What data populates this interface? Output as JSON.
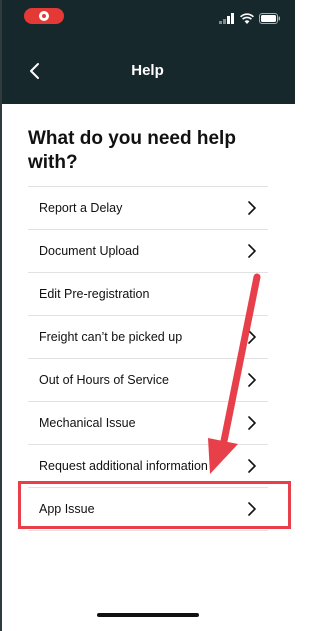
{
  "header": {
    "title": "Help"
  },
  "page": {
    "title": "What do you need help with?"
  },
  "help_items": [
    {
      "label": "Report a Delay"
    },
    {
      "label": "Document Upload"
    },
    {
      "label": "Edit Pre-registration"
    },
    {
      "label": "Freight can’t be picked up"
    },
    {
      "label": "Out of Hours of Service"
    },
    {
      "label": "Mechanical Issue"
    },
    {
      "label": "Request additional information"
    },
    {
      "label": "App Issue"
    }
  ],
  "icons": {
    "back": "chevron-left-icon",
    "row_chevron": "chevron-right-icon",
    "signal": "cellular-signal-icon",
    "wifi": "wifi-icon",
    "battery": "battery-icon",
    "record": "screen-recording-indicator-icon"
  },
  "colors": {
    "header_bg": "#16282b",
    "highlight": "#e8404a",
    "record": "#e53935"
  }
}
